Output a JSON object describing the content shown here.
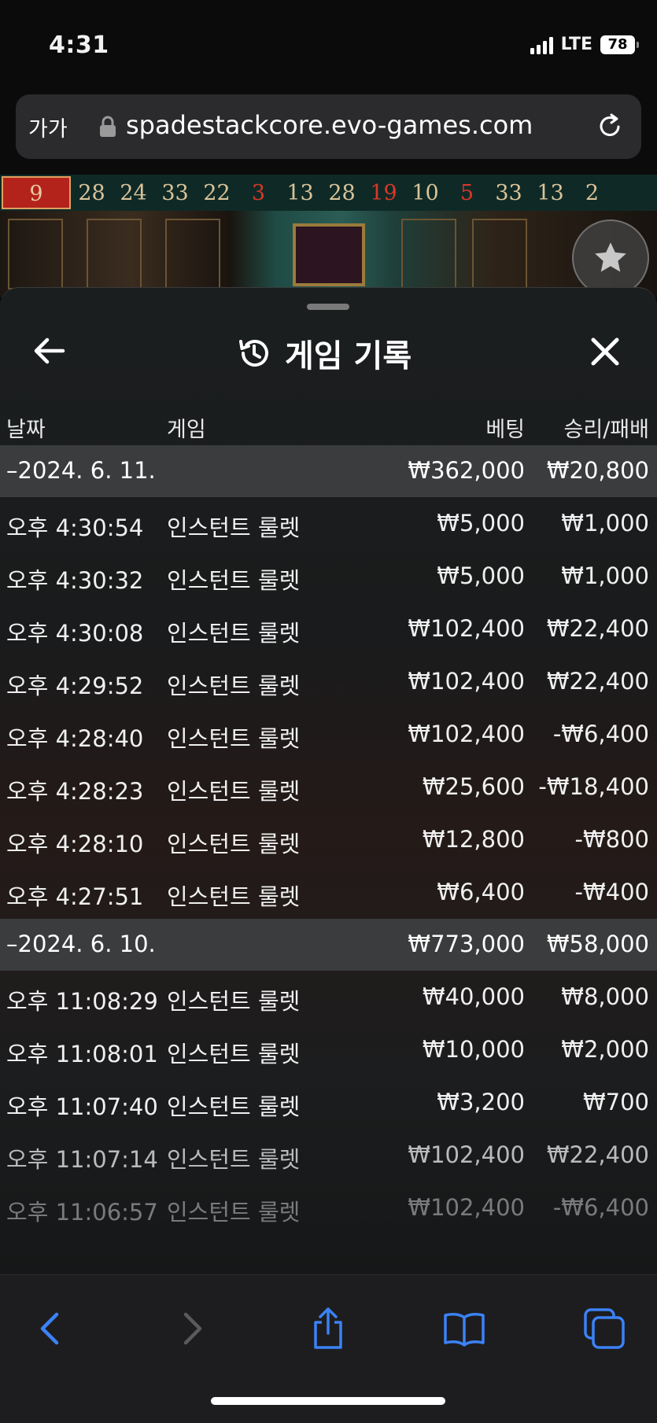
{
  "status_bar": {
    "time": "4:31",
    "network": "LTE",
    "battery": "78"
  },
  "browser": {
    "text_size_label": "가가",
    "url": "spadestackcore.evo-games.com"
  },
  "roulette_history": [
    {
      "n": "9",
      "color": "red"
    },
    {
      "n": "28",
      "color": "black"
    },
    {
      "n": "24",
      "color": "black"
    },
    {
      "n": "33",
      "color": "black"
    },
    {
      "n": "22",
      "color": "black"
    },
    {
      "n": "3",
      "color": "red"
    },
    {
      "n": "13",
      "color": "black"
    },
    {
      "n": "28",
      "color": "black"
    },
    {
      "n": "19",
      "color": "red"
    },
    {
      "n": "10",
      "color": "black"
    },
    {
      "n": "5",
      "color": "red"
    },
    {
      "n": "33",
      "color": "black"
    },
    {
      "n": "13",
      "color": "black"
    },
    {
      "n": "2",
      "color": "black"
    }
  ],
  "sheet": {
    "title": "게임 기록",
    "columns": {
      "date": "날짜",
      "game": "게임",
      "bet": "베팅",
      "result": "승리/패배"
    }
  },
  "groups": [
    {
      "date": "–2024. 6. 11.",
      "bet_total": "₩362,000",
      "result_total": "₩20,800",
      "rows": [
        {
          "time": "오후 4:30:54",
          "game": "인스턴트 룰렛",
          "bet": "₩5,000",
          "result": "₩1,000"
        },
        {
          "time": "오후 4:30:32",
          "game": "인스턴트 룰렛",
          "bet": "₩5,000",
          "result": "₩1,000"
        },
        {
          "time": "오후 4:30:08",
          "game": "인스턴트 룰렛",
          "bet": "₩102,400",
          "result": "₩22,400"
        },
        {
          "time": "오후 4:29:52",
          "game": "인스턴트 룰렛",
          "bet": "₩102,400",
          "result": "₩22,400"
        },
        {
          "time": "오후 4:28:40",
          "game": "인스턴트 룰렛",
          "bet": "₩102,400",
          "result": "-₩6,400"
        },
        {
          "time": "오후 4:28:23",
          "game": "인스턴트 룰렛",
          "bet": "₩25,600",
          "result": "-₩18,400"
        },
        {
          "time": "오후 4:28:10",
          "game": "인스턴트 룰렛",
          "bet": "₩12,800",
          "result": "-₩800"
        },
        {
          "time": "오후 4:27:51",
          "game": "인스턴트 룰렛",
          "bet": "₩6,400",
          "result": "-₩400"
        }
      ]
    },
    {
      "date": "–2024. 6. 10.",
      "bet_total": "₩773,000",
      "result_total": "₩58,000",
      "rows": [
        {
          "time": "오후 11:08:29",
          "game": "인스턴트 룰렛",
          "bet": "₩40,000",
          "result": "₩8,000"
        },
        {
          "time": "오후 11:08:01",
          "game": "인스턴트 룰렛",
          "bet": "₩10,000",
          "result": "₩2,000"
        },
        {
          "time": "오후 11:07:40",
          "game": "인스턴트 룰렛",
          "bet": "₩3,200",
          "result": "₩700"
        },
        {
          "time": "오후 11:07:14",
          "game": "인스턴트 룰렛",
          "bet": "₩102,400",
          "result": "₩22,400"
        },
        {
          "time": "오후 11:06:57",
          "game": "인스턴트 룰렛",
          "bet": "₩102,400",
          "result": "-₩6,400"
        }
      ]
    }
  ],
  "colors": {
    "red_number": "#d9372a",
    "gold_number": "#d9c39a",
    "ios_blue": "#3b82f6",
    "group_bg": "#3b3c3d"
  }
}
